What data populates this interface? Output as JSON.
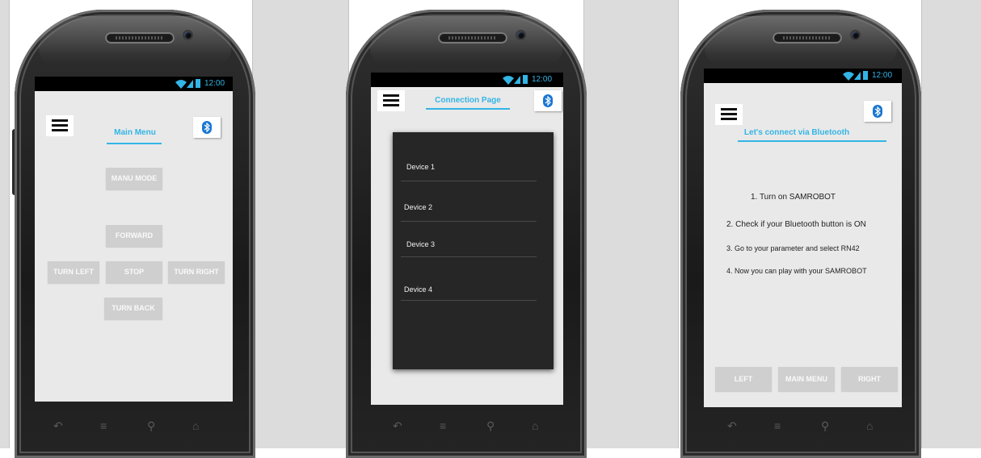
{
  "status": {
    "time": "12:00"
  },
  "colors": {
    "accent": "#33b5e5",
    "bluetooth": "#1976d2",
    "button": "#cfcfcf",
    "panel": "#262626"
  },
  "screen1": {
    "title": "Main Menu",
    "buttons": {
      "manu_mode": "MANU MODE",
      "forward": "FORWARD",
      "turn_left": "TURN LEFT",
      "stop": "STOP",
      "turn_right": "TURN RIGHT",
      "turn_back": "TURN BACK"
    }
  },
  "screen2": {
    "title": "Connection Page",
    "devices": [
      "Device 1",
      "Device 2",
      "Device 3",
      "Device 4"
    ]
  },
  "screen3": {
    "title": "Let's connect via Bluetooth",
    "steps": [
      "1. Turn on SAMROBOT",
      "2. Check if your Bluetooth button is ON",
      "3. Go to your parameter and select RN42",
      "4. Now you can play with your SAMROBOT"
    ],
    "buttons": {
      "left": "LEFT",
      "main_menu": "MAIN MENU",
      "right": "RIGHT"
    }
  },
  "icons": [
    "menu-icon",
    "bluetooth-icon",
    "wifi-icon",
    "signal-icon",
    "battery-icon",
    "back-icon",
    "recent-apps-icon",
    "search-icon",
    "home-icon"
  ]
}
